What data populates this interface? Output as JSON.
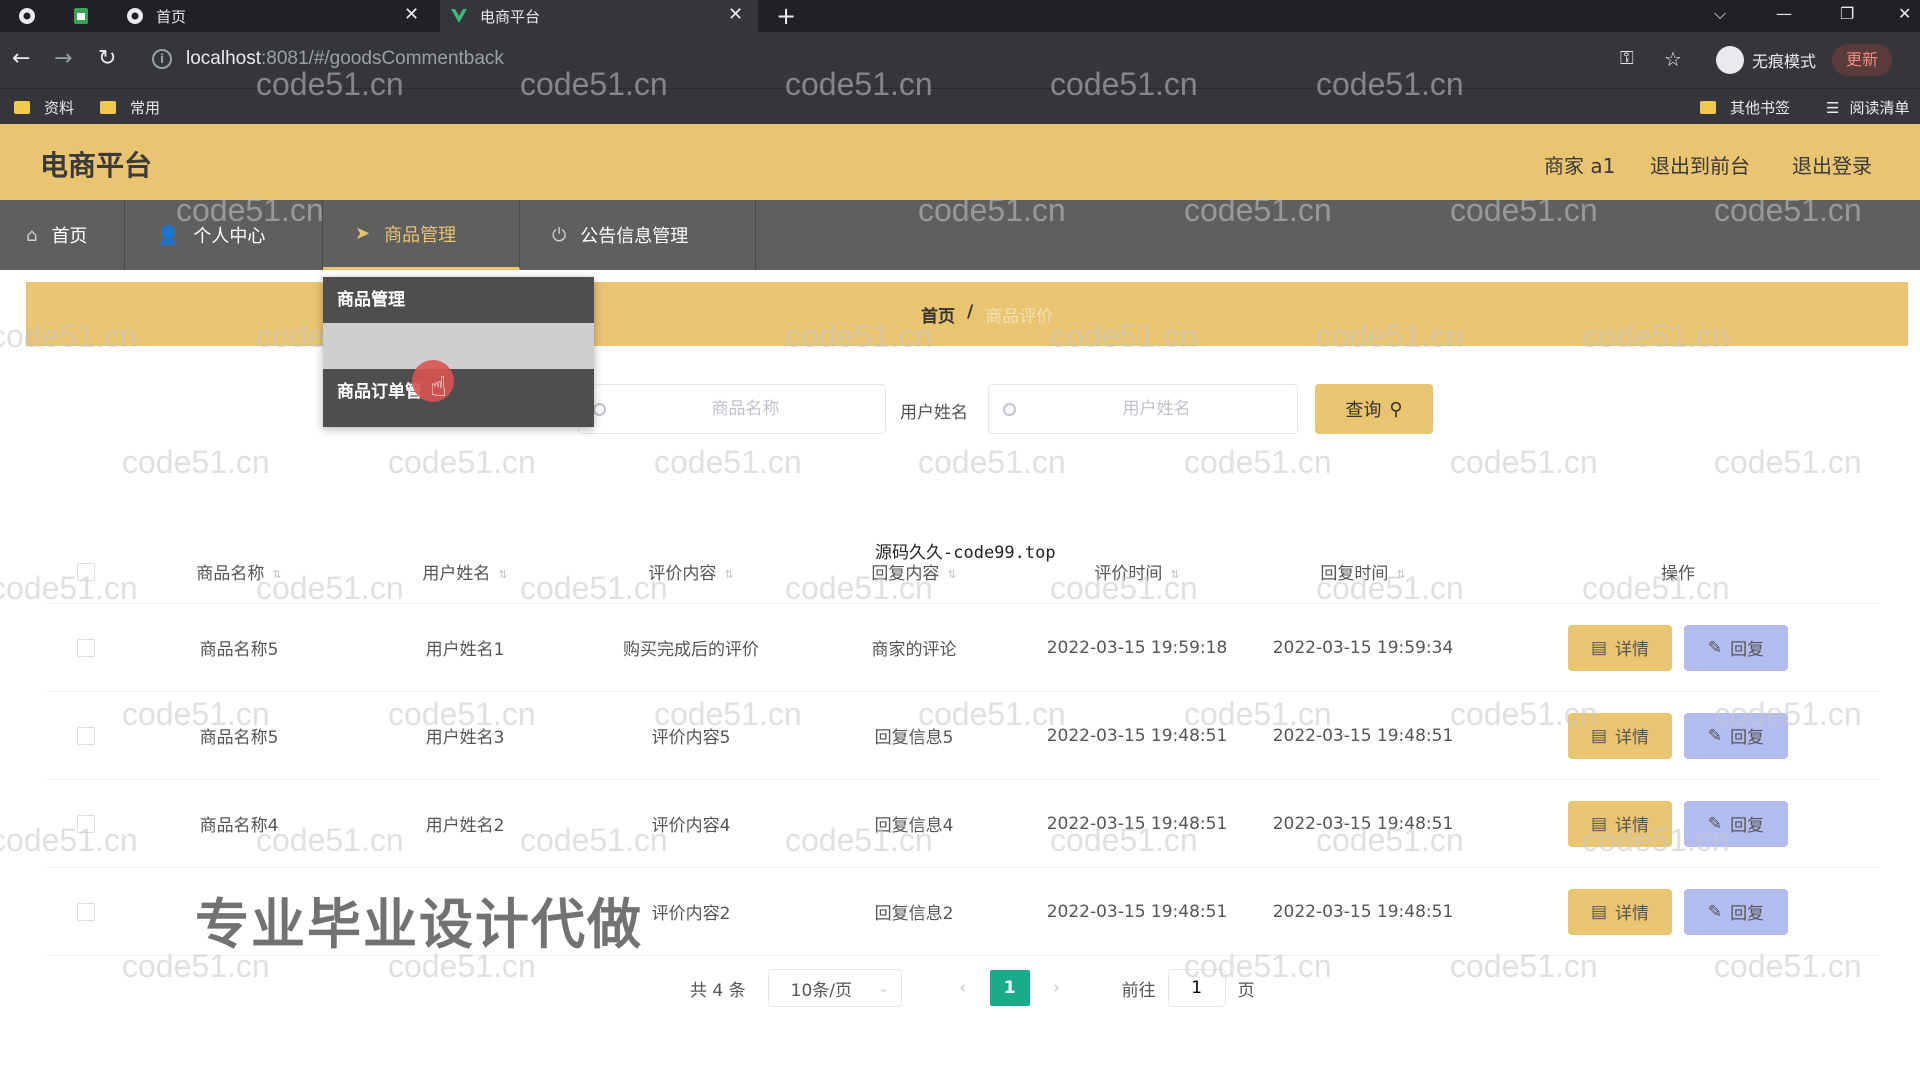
{
  "browser": {
    "tabs": [
      {
        "title": "首页"
      },
      {
        "title": "电商平台"
      }
    ],
    "url_host": "localhost",
    "url_path": ":8081/#/goodsCommentback",
    "incognito_label": "无痕模式",
    "update_label": "更新",
    "bookmarks": [
      "资料",
      "常用"
    ],
    "bookmarks_right": [
      "其他书签",
      "阅读清单"
    ]
  },
  "header": {
    "brand": "电商平台",
    "user": "商家 a1",
    "to_front": "退出到前台",
    "logout": "退出登录",
    "color": "#e9c471"
  },
  "nav": {
    "items": [
      {
        "label": "首页",
        "icon": "home-icon"
      },
      {
        "label": "个人中心",
        "icon": "user-icon"
      },
      {
        "label": "商品管理",
        "icon": "send-icon"
      },
      {
        "label": "公告信息管理",
        "icon": "power-icon"
      }
    ]
  },
  "dropdown": {
    "items": [
      "商品管理",
      "",
      "商品订单管"
    ]
  },
  "breadcrumb": {
    "home": "首页",
    "sep": "/",
    "current": "商品评价"
  },
  "search": {
    "goods_placeholder": "商品名称",
    "user_label": "用户姓名",
    "user_placeholder": "用户姓名",
    "query_label": "查询"
  },
  "table": {
    "headers": [
      "商品名称",
      "用户姓名",
      "评价内容",
      "回复内容",
      "评价时间",
      "回复时间",
      "操作"
    ],
    "detail_label": "详情",
    "reply_label": "回复",
    "rows": [
      {
        "goods": "商品名称5",
        "user": "用户姓名1",
        "content": "购买完成后的评价",
        "reply": "商家的评论",
        "time": "2022-03-15 19:59:18",
        "reply_time": "2022-03-15 19:59:34"
      },
      {
        "goods": "商品名称5",
        "user": "用户姓名3",
        "content": "评价内容5",
        "reply": "回复信息5",
        "time": "2022-03-15 19:48:51",
        "reply_time": "2022-03-15 19:48:51"
      },
      {
        "goods": "商品名称4",
        "user": "用户姓名2",
        "content": "评价内容4",
        "reply": "回复信息4",
        "time": "2022-03-15 19:48:51",
        "reply_time": "2022-03-15 19:48:51"
      },
      {
        "goods": "",
        "user": "",
        "content": "评价内容2",
        "reply": "回复信息2",
        "time": "2022-03-15 19:48:51",
        "reply_time": "2022-03-15 19:48:51"
      }
    ]
  },
  "pagination": {
    "total": "共 4 条",
    "page_size": "10条/页",
    "current_page": "1",
    "goto_label": "前往",
    "goto_value": "1",
    "page_suffix": "页"
  },
  "overlay": {
    "center_text": "源码久久-code99.top",
    "promo_text": "专业毕业设计代做",
    "watermark": "code51.cn"
  }
}
